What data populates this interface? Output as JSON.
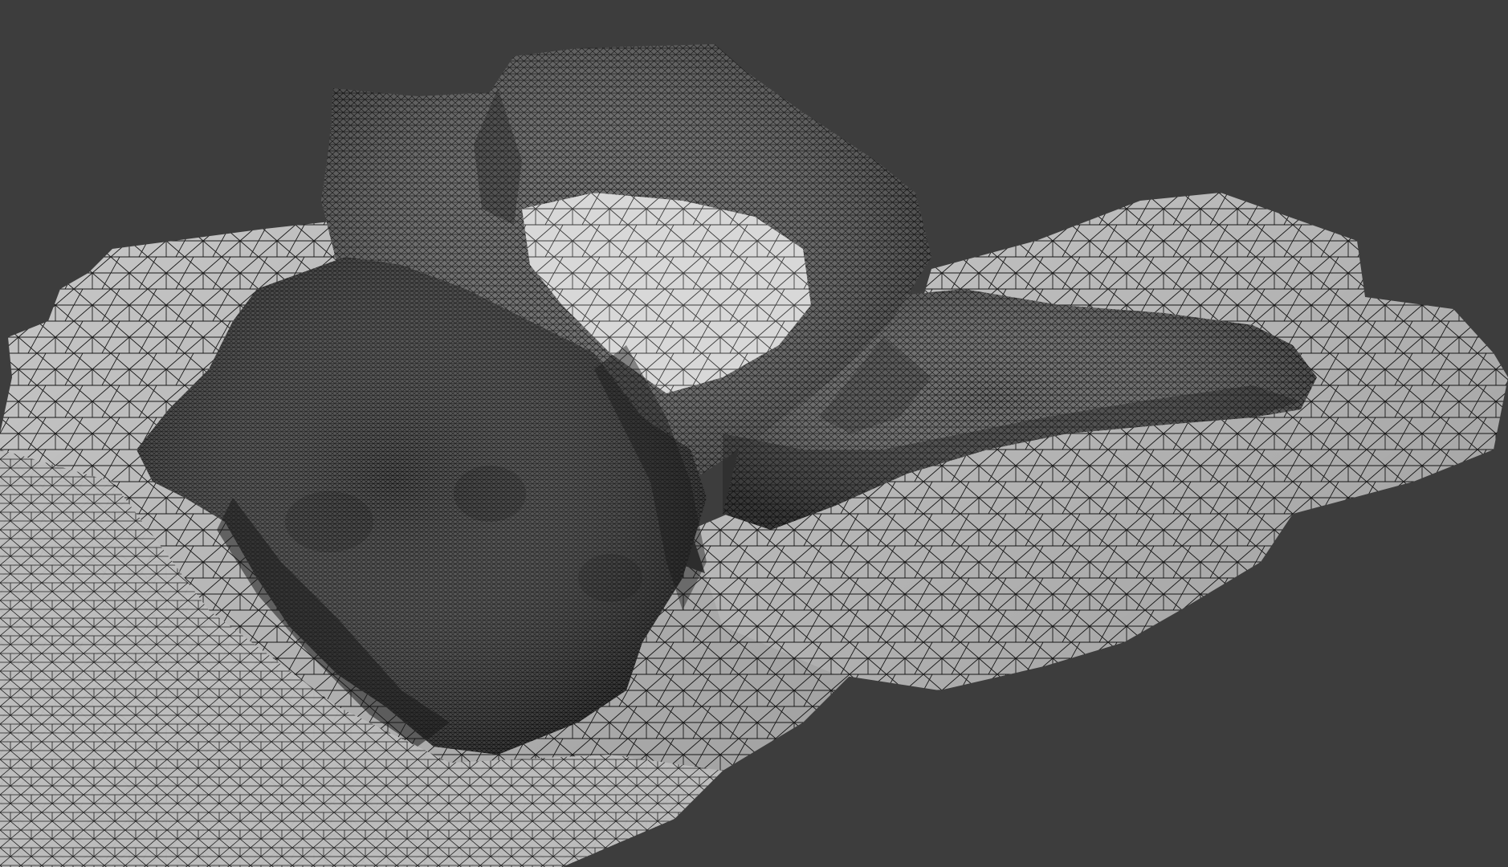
{
  "viewport": {
    "background_color": "#3d3d3d",
    "content": "wireframe-mesh-render",
    "mesh": {
      "fill_light": "#cfcfcf",
      "fill_shadow": "#8a8a8a",
      "fill_dark": "#5a5a5a",
      "wire_color": "#141414"
    }
  }
}
